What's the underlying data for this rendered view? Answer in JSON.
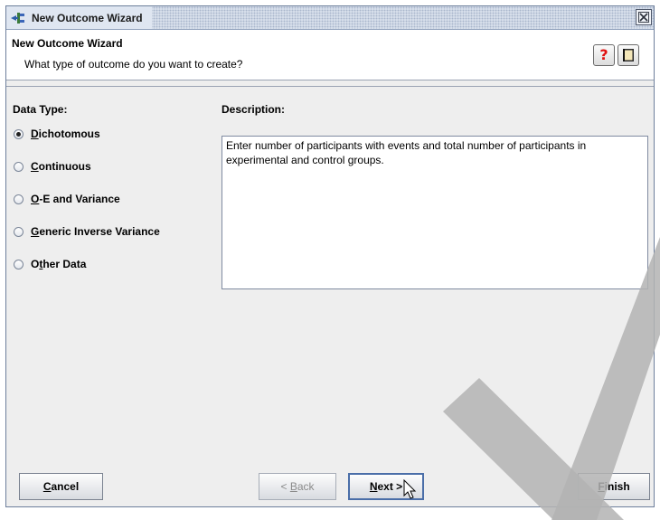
{
  "window": {
    "title": "New Outcome Wizard"
  },
  "header": {
    "title": "New Outcome Wizard",
    "subtitle": "What type of outcome do you want to create?"
  },
  "main": {
    "data_type_label": "Data Type:",
    "description_label": "Description:",
    "options": [
      {
        "underline": "D",
        "rest": "ichotomous",
        "selected": true
      },
      {
        "underline": "C",
        "rest": "ontinuous",
        "selected": false
      },
      {
        "underline": "O",
        "rest": "-E and Variance",
        "selected": false
      },
      {
        "underline": "G",
        "rest": "eneric Inverse Variance",
        "selected": false
      },
      {
        "pre": "O",
        "underline": "t",
        "rest": "her Data",
        "selected": false
      }
    ],
    "description_text": "Enter number of participants with events and total number of participants in experimental and control groups."
  },
  "footer": {
    "cancel": {
      "underline": "C",
      "rest": "ancel"
    },
    "back": {
      "pre": "< ",
      "underline": "B",
      "rest": "ack"
    },
    "next": {
      "underline": "N",
      "rest": "ext >"
    },
    "finish": {
      "underline": "F",
      "rest": "inish"
    }
  },
  "icons": {
    "app": "wizard-icon",
    "close": "close-icon",
    "help": "help-icon",
    "book": "book-icon",
    "cursor": "mouse-pointer-icon"
  }
}
